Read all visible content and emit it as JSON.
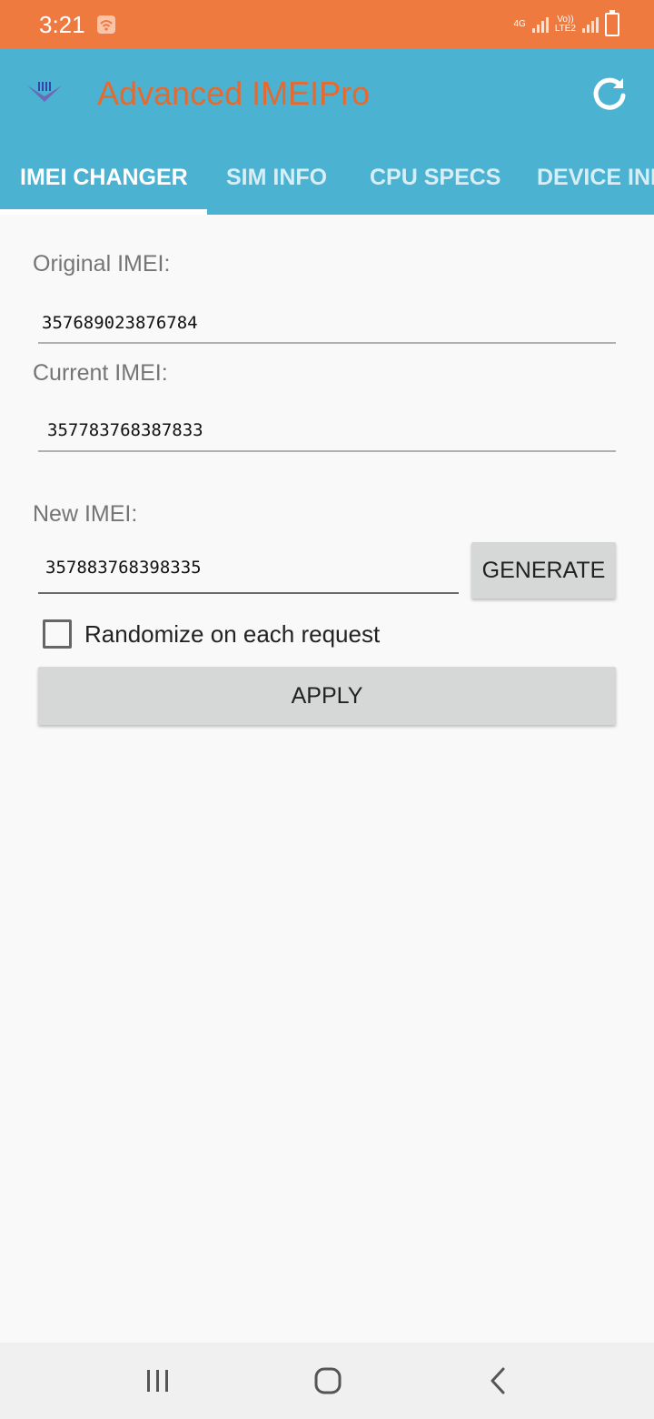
{
  "status_bar": {
    "time": "3:21",
    "network_4g": "4G",
    "volte_top": "Vo))",
    "volte_bottom": "LTE2",
    "background": "#ee7a40"
  },
  "app_bar": {
    "title": "Advanced IMEIPro",
    "title_color": "#e7692d",
    "background": "#4bb2d2",
    "icons": [
      "app-logo-icon",
      "refresh-icon"
    ]
  },
  "tabs": [
    {
      "label": "IMEI CHANGER",
      "active": true
    },
    {
      "label": "SIM INFO",
      "active": false
    },
    {
      "label": "CPU SPECS",
      "active": false
    },
    {
      "label": "DEVICE INFO",
      "active": false
    }
  ],
  "imei_form": {
    "original_label": "Original IMEI:",
    "original_value": "357689023876784",
    "current_label": "Current IMEI:",
    "current_value": "357783768387833",
    "new_label": "New IMEI:",
    "new_value": "357883768398335",
    "generate_label": "GENERATE",
    "randomize_label": "Randomize on each request",
    "randomize_checked": false,
    "apply_label": "APPLY"
  },
  "nav_bar": {
    "icons": [
      "recent-apps-icon",
      "home-icon",
      "back-icon"
    ]
  }
}
